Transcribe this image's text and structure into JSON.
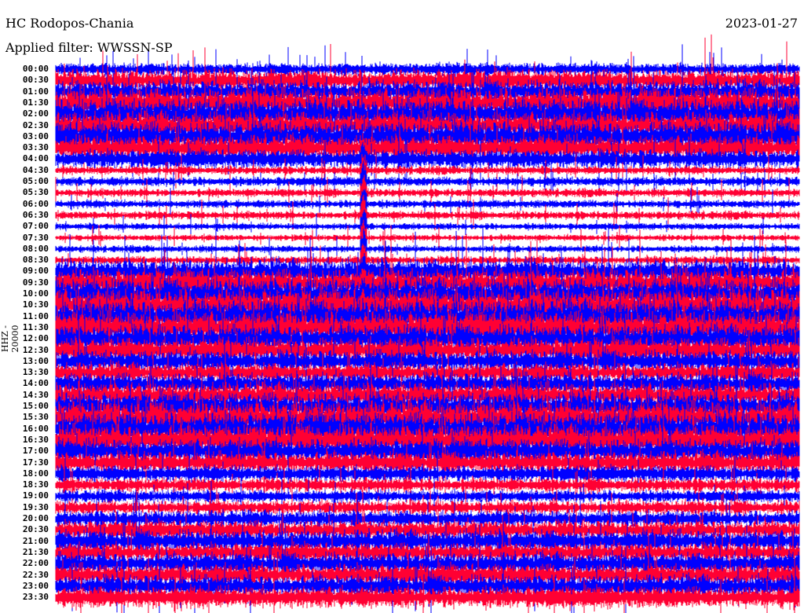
{
  "header": {
    "station": "HC Rodopos-Chania",
    "date": "2023-01-27",
    "filter": "Applied filter: WWSSN-SP"
  },
  "chart_data": {
    "type": "line",
    "title": "HC Rodopos-Chania",
    "ylabel": "HHZ - 20000",
    "row_labels": [
      "00:00",
      "00:30",
      "01:00",
      "01:30",
      "02:00",
      "02:30",
      "03:00",
      "03:30",
      "04:00",
      "04:30",
      "05:00",
      "05:30",
      "06:00",
      "06:30",
      "07:00",
      "07:30",
      "08:00",
      "08:30",
      "09:00",
      "09:30",
      "10:00",
      "10:30",
      "11:00",
      "11:30",
      "12:00",
      "12:30",
      "13:00",
      "13:30",
      "14:00",
      "14:30",
      "15:00",
      "15:30",
      "16:00",
      "16:30",
      "17:00",
      "17:30",
      "18:00",
      "18:30",
      "19:00",
      "19:30",
      "20:00",
      "20:30",
      "21:00",
      "21:30",
      "22:00",
      "22:30",
      "23:00",
      "23:30"
    ],
    "row_colors": [
      "#0000ff",
      "#ff0033"
    ],
    "relative_amplitude": [
      0.9,
      1.6,
      1.6,
      2.2,
      2.2,
      2.0,
      2.2,
      1.8,
      1.4,
      0.6,
      0.7,
      0.6,
      0.6,
      0.6,
      0.5,
      0.45,
      0.5,
      0.6,
      1.8,
      2.0,
      2.2,
      2.4,
      2.4,
      2.4,
      2.0,
      1.8,
      1.6,
      1.4,
      1.6,
      1.8,
      2.0,
      2.4,
      2.4,
      2.2,
      1.8,
      1.6,
      1.2,
      1.0,
      0.9,
      1.0,
      1.2,
      1.4,
      1.6,
      1.4,
      1.6,
      1.6,
      1.6,
      1.6
    ],
    "event": {
      "start_row": "04:00",
      "end_row": "10:30",
      "note": ""
    }
  }
}
